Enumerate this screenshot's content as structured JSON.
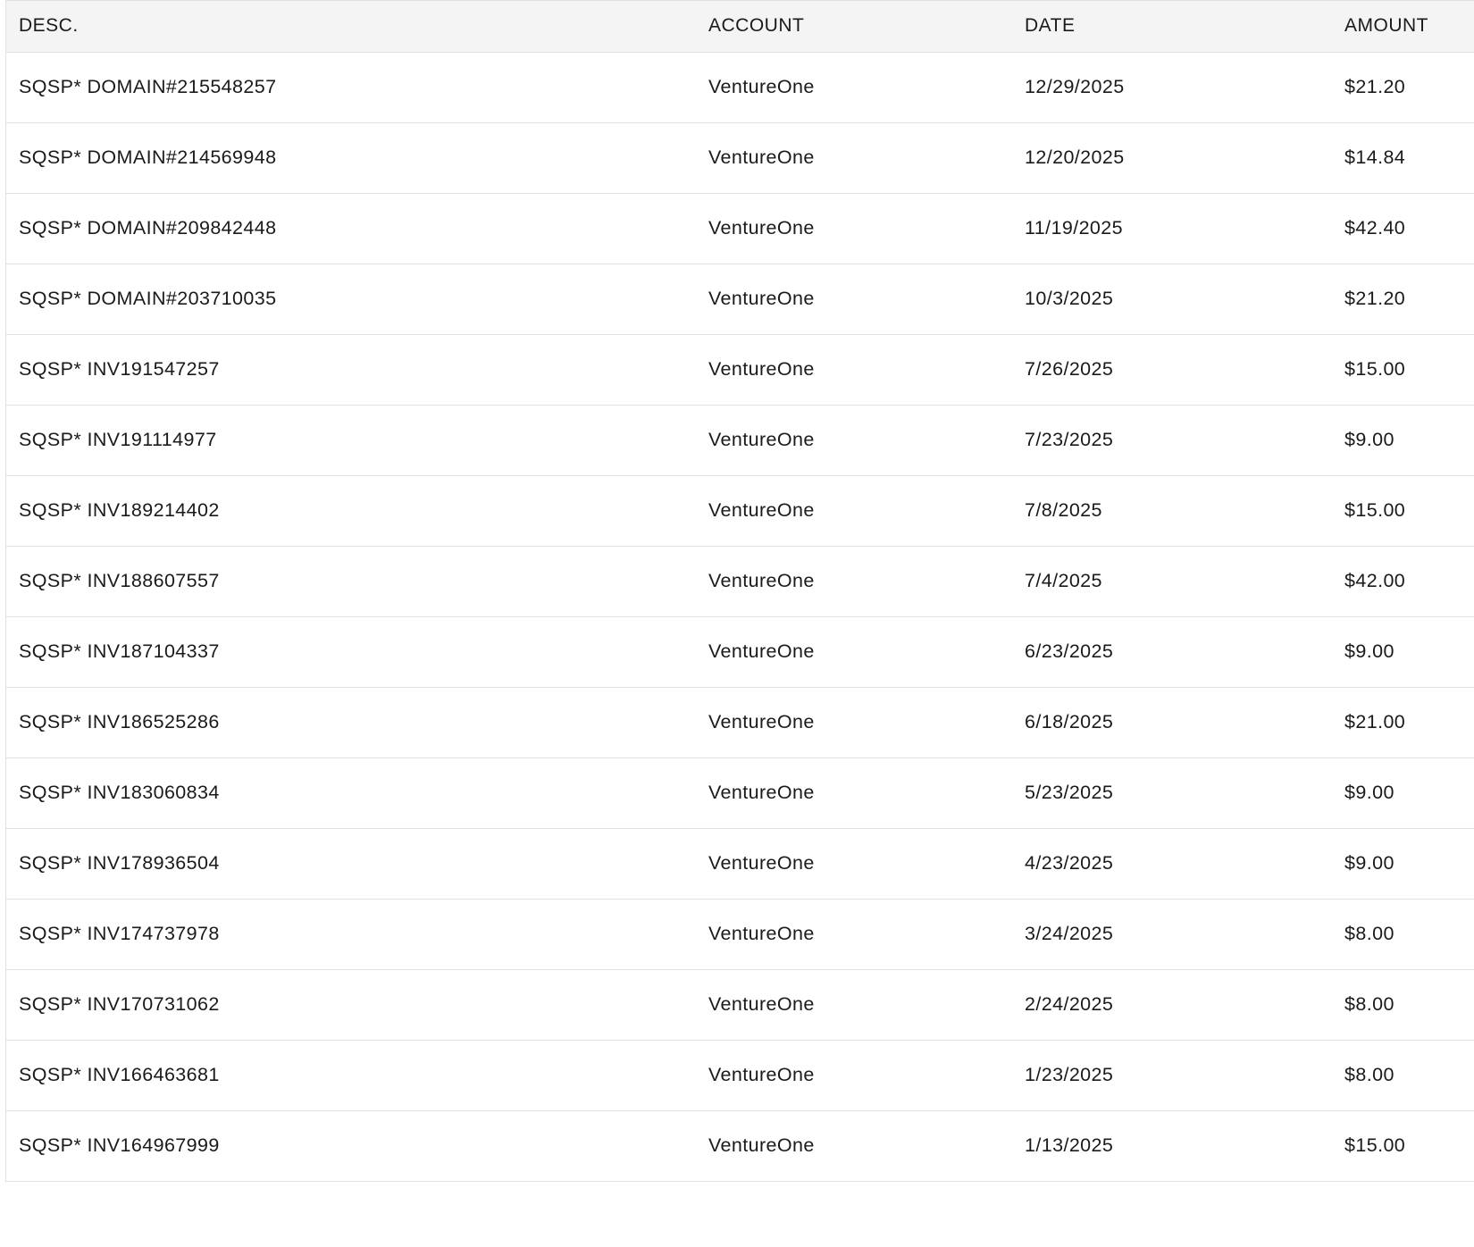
{
  "table": {
    "headers": {
      "desc": "DESC.",
      "account": "ACCOUNT",
      "date": "DATE",
      "amount": "AMOUNT"
    },
    "rows": [
      {
        "desc": "SQSP* DOMAIN#215548257",
        "account": "VentureOne",
        "date": "12/29/2025",
        "amount": "$21.20"
      },
      {
        "desc": "SQSP* DOMAIN#214569948",
        "account": "VentureOne",
        "date": "12/20/2025",
        "amount": "$14.84"
      },
      {
        "desc": "SQSP* DOMAIN#209842448",
        "account": "VentureOne",
        "date": "11/19/2025",
        "amount": "$42.40"
      },
      {
        "desc": "SQSP* DOMAIN#203710035",
        "account": "VentureOne",
        "date": "10/3/2025",
        "amount": "$21.20"
      },
      {
        "desc": "SQSP* INV191547257",
        "account": "VentureOne",
        "date": "7/26/2025",
        "amount": "$15.00"
      },
      {
        "desc": "SQSP* INV191114977",
        "account": "VentureOne",
        "date": "7/23/2025",
        "amount": "$9.00"
      },
      {
        "desc": "SQSP* INV189214402",
        "account": "VentureOne",
        "date": "7/8/2025",
        "amount": "$15.00"
      },
      {
        "desc": "SQSP* INV188607557",
        "account": "VentureOne",
        "date": "7/4/2025",
        "amount": "$42.00"
      },
      {
        "desc": "SQSP* INV187104337",
        "account": "VentureOne",
        "date": "6/23/2025",
        "amount": "$9.00"
      },
      {
        "desc": "SQSP* INV186525286",
        "account": "VentureOne",
        "date": "6/18/2025",
        "amount": "$21.00"
      },
      {
        "desc": "SQSP* INV183060834",
        "account": "VentureOne",
        "date": "5/23/2025",
        "amount": "$9.00"
      },
      {
        "desc": "SQSP* INV178936504",
        "account": "VentureOne",
        "date": "4/23/2025",
        "amount": "$9.00"
      },
      {
        "desc": "SQSP* INV174737978",
        "account": "VentureOne",
        "date": "3/24/2025",
        "amount": "$8.00"
      },
      {
        "desc": "SQSP* INV170731062",
        "account": "VentureOne",
        "date": "2/24/2025",
        "amount": "$8.00"
      },
      {
        "desc": "SQSP* INV166463681",
        "account": "VentureOne",
        "date": "1/23/2025",
        "amount": "$8.00"
      },
      {
        "desc": "SQSP* INV164967999",
        "account": "VentureOne",
        "date": "1/13/2025",
        "amount": "$15.00"
      }
    ]
  }
}
